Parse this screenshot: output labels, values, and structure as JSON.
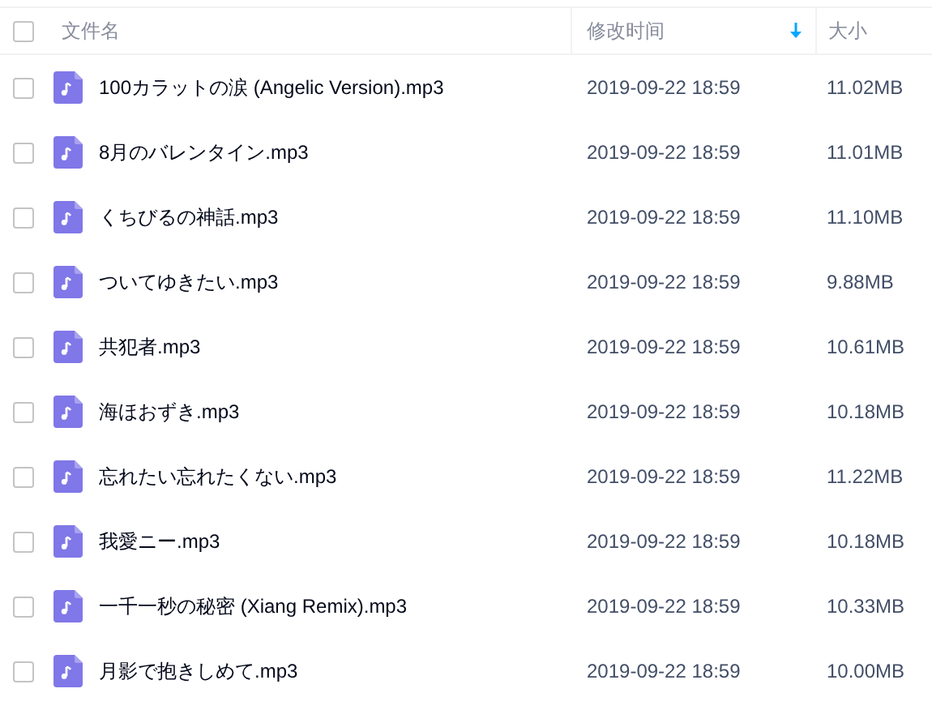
{
  "header": {
    "checked": false,
    "columns": [
      {
        "label": "文件名",
        "sorted": false
      },
      {
        "label": "修改时间",
        "sorted": true
      },
      {
        "label": "大小",
        "sorted": false
      }
    ]
  },
  "rows": [
    {
      "checked": false,
      "name": "100カラットの涙 (Angelic Version).mp3",
      "modified": "2019-09-22 18:59",
      "size": "11.02MB"
    },
    {
      "checked": false,
      "name": "8月のバレンタイン.mp3",
      "modified": "2019-09-22 18:59",
      "size": "11.01MB"
    },
    {
      "checked": false,
      "name": "くちびるの神話.mp3",
      "modified": "2019-09-22 18:59",
      "size": "11.10MB"
    },
    {
      "checked": false,
      "name": "ついてゆきたい.mp3",
      "modified": "2019-09-22 18:59",
      "size": "9.88MB"
    },
    {
      "checked": false,
      "name": "共犯者.mp3",
      "modified": "2019-09-22 18:59",
      "size": "10.61MB"
    },
    {
      "checked": false,
      "name": "海ほおずき.mp3",
      "modified": "2019-09-22 18:59",
      "size": "10.18MB"
    },
    {
      "checked": false,
      "name": "忘れたい忘れたくない.mp3",
      "modified": "2019-09-22 18:59",
      "size": "11.22MB"
    },
    {
      "checked": false,
      "name": "我愛ニー.mp3",
      "modified": "2019-09-22 18:59",
      "size": "10.18MB"
    },
    {
      "checked": false,
      "name": "一千一秒の秘密 (Xiang Remix).mp3",
      "modified": "2019-09-22 18:59",
      "size": "10.33MB"
    },
    {
      "checked": false,
      "name": "月影で抱きしめて.mp3",
      "modified": "2019-09-22 18:59",
      "size": "10.00MB"
    }
  ]
}
